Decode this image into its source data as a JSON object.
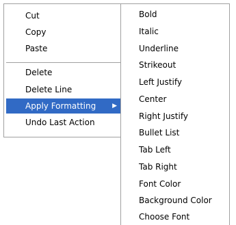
{
  "context_menu": {
    "items": [
      {
        "label": "Cut"
      },
      {
        "label": "Copy"
      },
      {
        "label": "Paste"
      },
      {
        "label": "Delete"
      },
      {
        "label": "Delete Line"
      },
      {
        "label": "Apply Formatting",
        "state": "highlighted",
        "has_submenu": true
      },
      {
        "label": "Undo Last Action"
      }
    ],
    "submenu_arrow_icon": "triangle-right-icon",
    "highlight_color": "#316ac5"
  },
  "formatting_submenu": {
    "items": [
      {
        "label": "Bold"
      },
      {
        "label": "Italic"
      },
      {
        "label": "Underline"
      },
      {
        "label": "Strikeout"
      },
      {
        "label": "Left Justify"
      },
      {
        "label": "Center"
      },
      {
        "label": "Right Justify"
      },
      {
        "label": "Bullet List"
      },
      {
        "label": "Tab Left"
      },
      {
        "label": "Tab Right"
      },
      {
        "label": "Font Color"
      },
      {
        "label": "Background Color"
      },
      {
        "label": "Choose Font"
      }
    ]
  }
}
